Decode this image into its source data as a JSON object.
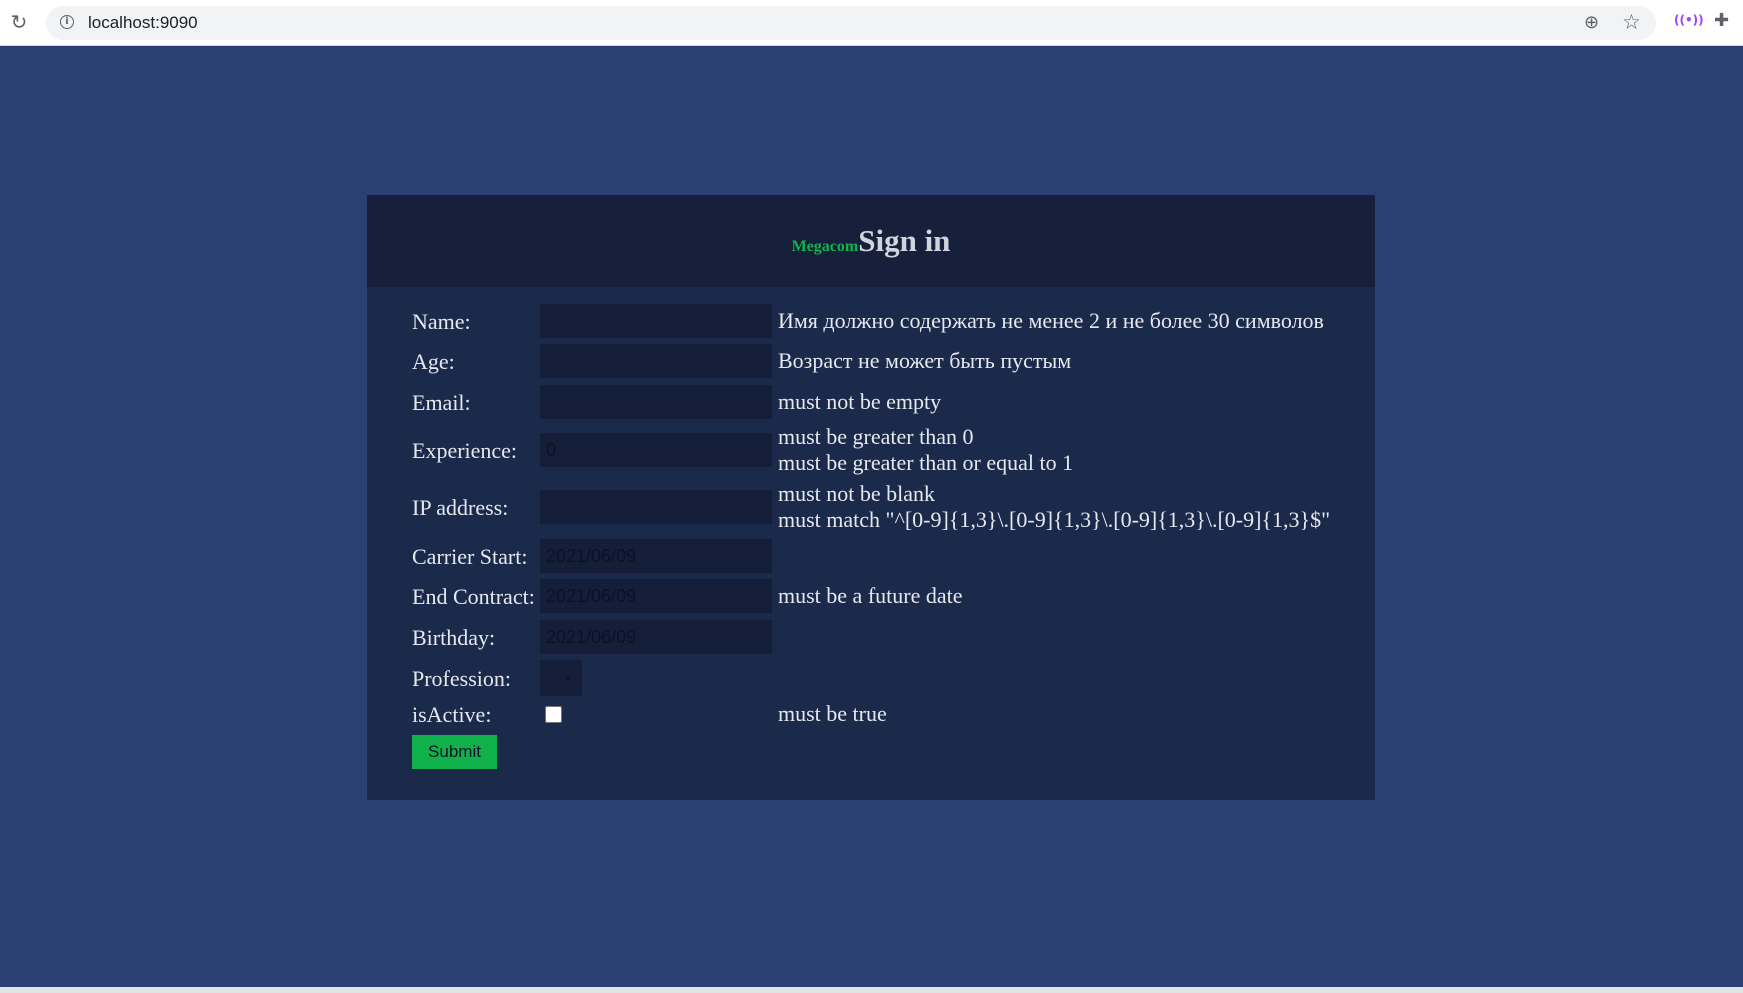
{
  "browser": {
    "url": "localhost:9090",
    "reload_icon": "reload-icon",
    "info_icon": "info-icon",
    "zoom_icon": "zoom-icon",
    "bookmark_icon": "star-icon",
    "cast_icon": "cast-icon",
    "extensions_icon": "puzzle-icon"
  },
  "header": {
    "brand": "Megacom",
    "title": "Sign in"
  },
  "form": {
    "name": {
      "label": "Name:",
      "value": "",
      "error": "Имя должно содержать не менее 2 и не более 30 символов"
    },
    "age": {
      "label": "Age:",
      "value": "",
      "error": "Возраст не может быть пустым"
    },
    "email": {
      "label": "Email:",
      "value": "",
      "error": "must not be empty"
    },
    "experience": {
      "label": "Experience:",
      "value": "0",
      "error1": "must be greater than 0",
      "error2": "must be greater than or equal to 1"
    },
    "ip": {
      "label": "IP address:",
      "value": "",
      "error1": "must not be blank",
      "error2": "must match \"^[0-9]{1,3}\\.[0-9]{1,3}\\.[0-9]{1,3}\\.[0-9]{1,3}$\""
    },
    "carrier_start": {
      "label": "Carrier Start:",
      "value": "2021/06/09"
    },
    "end_contract": {
      "label": "End Contract:",
      "value": "2021/06/09",
      "error": "must be a future date"
    },
    "birthday": {
      "label": "Birthday:",
      "value": "2021/06/09"
    },
    "profession": {
      "label": "Profession:",
      "selected": ""
    },
    "is_active": {
      "label": "isActive:",
      "checked": false,
      "error": "must be true"
    },
    "submit_label": "Submit"
  },
  "colors": {
    "page_bg": "#2b3f75",
    "card_bg": "#1b2a4b",
    "header_bg": "#16203b",
    "brand": "#13b24a",
    "submit_bg": "#10b04a"
  }
}
